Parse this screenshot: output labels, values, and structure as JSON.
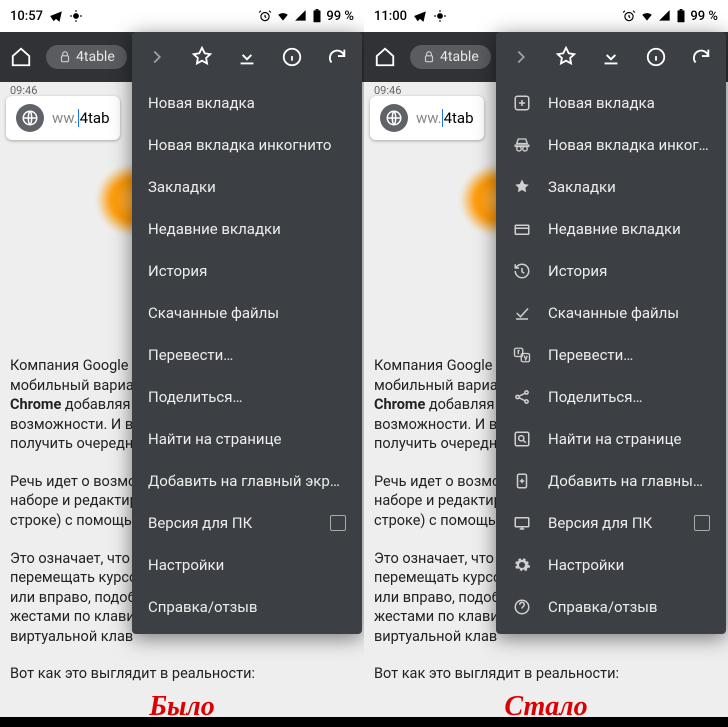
{
  "left": {
    "statusbar": {
      "time": "10:57",
      "battery": "99 %"
    },
    "toolbar": {
      "url": "4table"
    },
    "cursor": {
      "time": "09:46",
      "host": "ww.",
      "path": "4tab"
    },
    "article": {
      "p1a": "Компания Google ",
      "p1b": " мобильный вариа",
      "p1c_bold": "Chrome",
      "p1c_rest": " добавляя вари",
      "p1d": "возможности. И в ",
      "p1e": "получить очередн",
      "p2": "Речь идет о возмож",
      "p2b": "наборе и редактиро",
      "p2c": "строке) с помощь",
      "p3": "Это означает, что ",
      "p3b": "перемещать курсо",
      "p3c": "или вправо, подоб",
      "p3d": "жестами по клави",
      "p3e": "виртуальной клав",
      "p4": "Вот как это выглядит в реальности:"
    },
    "menu": {
      "items": [
        "Новая вкладка",
        "Новая вкладка инкогнито",
        "Закладки",
        "Недавние вкладки",
        "История",
        "Скачанные файлы",
        "Перевести…",
        "Поделиться…",
        "Найти на странице",
        "Добавить на главный экран",
        "Версия для ПК",
        "Настройки",
        "Справка/отзыв"
      ]
    },
    "caption": "Было"
  },
  "right": {
    "statusbar": {
      "time": "11:00",
      "battery": "99 %"
    },
    "toolbar": {
      "url": "4table"
    },
    "cursor": {
      "time": "09:46",
      "host": "ww.",
      "path": "4tab"
    },
    "article": {
      "p1a": "Компания Google ",
      "p1b": " мобильный вариа",
      "p1c_bold": "Chrome",
      "p1c_rest": " добавляя вари",
      "p1d": "возможности. И в ",
      "p1e": "получить очередн",
      "p2": "Речь идет о возмож",
      "p2b": "наборе и редактиро",
      "p2c": "строке) с помощь",
      "p3": "Это означает, что ",
      "p3b": "перемещать курсо",
      "p3c": "или вправо, подоб",
      "p3d": "жестами по клави",
      "p3e": "виртуальной клав",
      "p4": "Вот как это выглядит в реальности:"
    },
    "menu": {
      "items": [
        "Новая вкладка",
        "Новая вкладка инкогн…",
        "Закладки",
        "Недавние вкладки",
        "История",
        "Скачанные файлы",
        "Перевести…",
        "Поделиться…",
        "Найти на странице",
        "Добавить на главный э…",
        "Версия для ПК",
        "Настройки",
        "Справка/отзыв"
      ],
      "icons": [
        "plus-box",
        "incognito",
        "star",
        "tabs",
        "history",
        "download-done",
        "translate",
        "share",
        "find",
        "add-home",
        "desktop",
        "gear",
        "help"
      ]
    },
    "caption": "Стало"
  }
}
